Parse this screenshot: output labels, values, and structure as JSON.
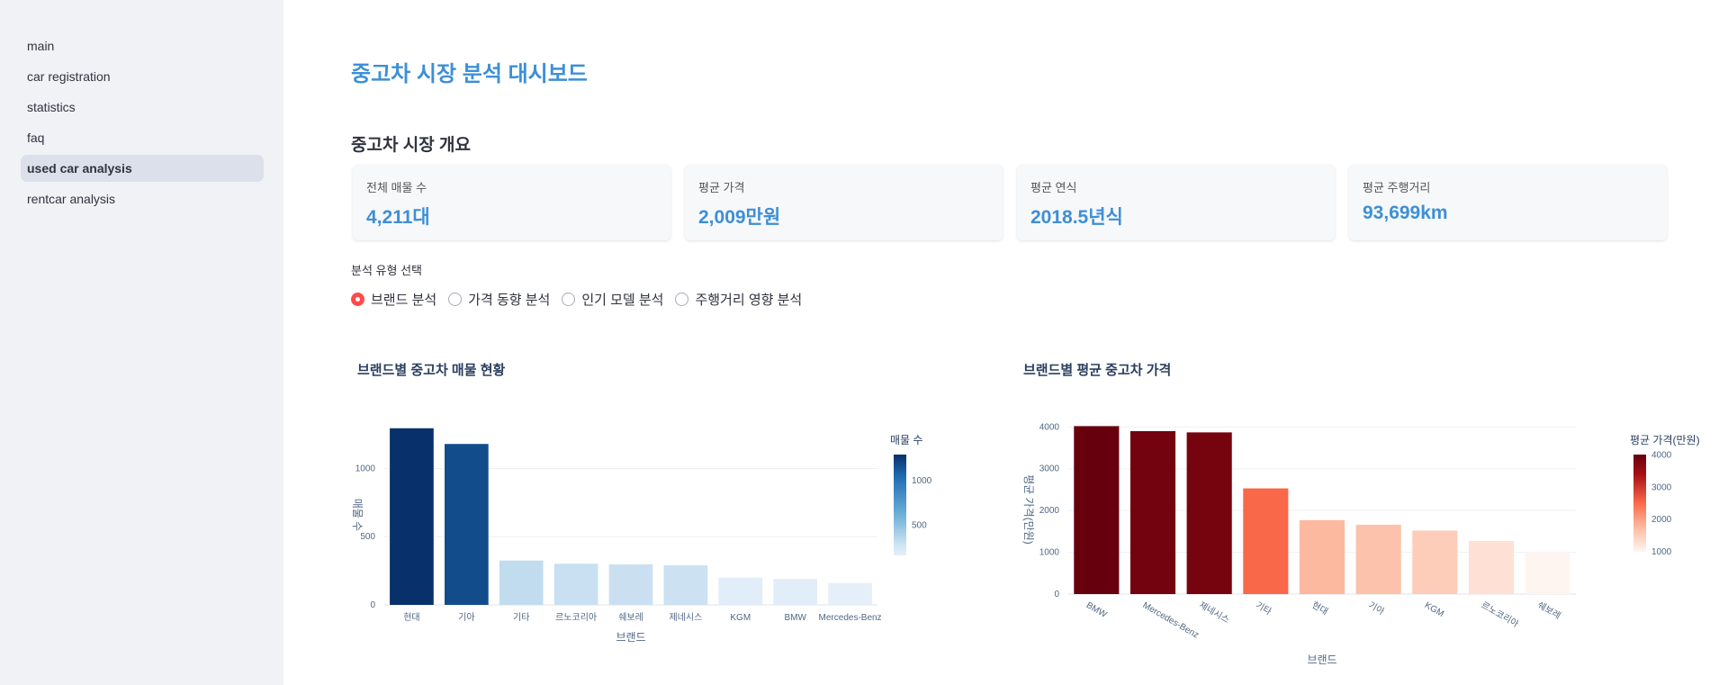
{
  "sidebar": {
    "items": [
      {
        "label": "main"
      },
      {
        "label": "car registration"
      },
      {
        "label": "statistics"
      },
      {
        "label": "faq"
      },
      {
        "label": "used car analysis"
      },
      {
        "label": "rentcar analysis"
      }
    ],
    "active_index": 4
  },
  "page": {
    "title": "중고차 시장 분석 대시보드",
    "section_title": "중고차 시장 개요"
  },
  "metrics": [
    {
      "label": "전체 매물 수",
      "value": "4,211대"
    },
    {
      "label": "평균 가격",
      "value": "2,009만원"
    },
    {
      "label": "평균 연식",
      "value": "2018.5년식"
    },
    {
      "label": "평균 주행거리",
      "value": "93,699km"
    }
  ],
  "analysis": {
    "label": "분석 유형 선택",
    "options": [
      "브랜드 분석",
      "가격 동향 분석",
      "인기 모델 분석",
      "주행거리 영향 분석"
    ],
    "selected": "브랜드 분석"
  },
  "colors": {
    "accent": "#3d8fd6",
    "radio_selected": "#ff4b4b",
    "sidebar_bg": "#f0f2f6"
  },
  "chart_data": [
    {
      "type": "bar",
      "title": "브랜드별 중고차 매물 현황",
      "xlabel": "브랜드",
      "ylabel": "매물 수",
      "categories": [
        "현대",
        "기아",
        "기타",
        "르노코리아",
        "쉐보레",
        "제네시스",
        "KGM",
        "BMW",
        "Mercedes-Benz"
      ],
      "values": [
        1295,
        1180,
        325,
        302,
        297,
        290,
        200,
        190,
        160
      ],
      "ylim": [
        0,
        1320
      ],
      "yticks": [
        0,
        500,
        1000
      ],
      "colorbar": {
        "title": "매물 수",
        "ticks": [
          500,
          1000
        ],
        "range": [
          160,
          1295
        ],
        "scale": "Blues"
      },
      "grid": true
    },
    {
      "type": "bar",
      "title": "브랜드별 평균 중고차 가격",
      "xlabel": "브랜드",
      "ylabel": "평균 가격(만원)",
      "categories": [
        "BMW",
        "Mercedes-Benz",
        "제네시스",
        "기타",
        "현대",
        "기아",
        "KGM",
        "르노코리아",
        "쉐보레"
      ],
      "values": [
        4020,
        3900,
        3870,
        2530,
        1770,
        1660,
        1520,
        1270,
        1000
      ],
      "ylim": [
        0,
        4050
      ],
      "yticks": [
        0,
        1000,
        2000,
        3000,
        4000
      ],
      "colorbar": {
        "title": "평균 가격(만원)",
        "ticks": [
          1000,
          2000,
          3000,
          4000
        ],
        "range": [
          1000,
          4020
        ],
        "scale": "Reds"
      },
      "grid": true
    }
  ]
}
